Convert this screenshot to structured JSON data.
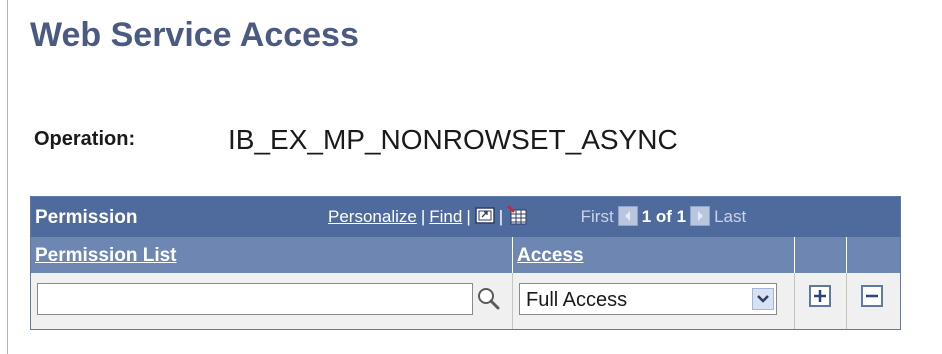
{
  "page": {
    "title": "Web Service Access"
  },
  "operation": {
    "label": "Operation:",
    "value": "IB_EX_MP_NONROWSET_ASYNC"
  },
  "grid": {
    "title": "Permission",
    "personalize": "Personalize",
    "find": "Find",
    "separator": "|",
    "first": "First",
    "count": "1 of 1",
    "last": "Last",
    "icons": [
      "view-all-icon",
      "download-spreadsheet-icon",
      "first-arrow-icon",
      "next-arrow-icon"
    ],
    "columns": {
      "permission_list": "Permission List",
      "access": "Access"
    },
    "row": {
      "permission_list_value": "",
      "access_value": "Full Access"
    }
  },
  "colors": {
    "title": "#4a5a80",
    "grid_header": "#4f6b9d",
    "column_header": "#6d86b2"
  }
}
